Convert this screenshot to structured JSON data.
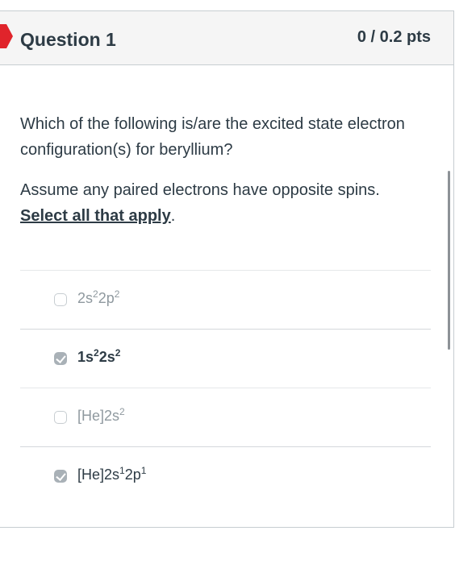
{
  "question": {
    "title": "Question 1",
    "points": "0 / 0.2 pts",
    "flag_icon": "flag-icon",
    "flag_color": "#e0242b"
  },
  "prompt": {
    "line1": "Which of the following is/are the excited state electron configuration(s) for beryllium?",
    "line2_prefix": "Assume any paired electrons have opposite spins.",
    "line2_emph": "Select all that apply",
    "line2_suffix": "."
  },
  "answers": [
    {
      "base": "2s",
      "sup1": "2",
      "mid": "2p",
      "sup2": "2",
      "checked": false
    },
    {
      "base": "1s",
      "sup1": "2",
      "mid": "2s",
      "sup2": "2",
      "checked": true
    },
    {
      "base": "[He]2s",
      "sup1": "2",
      "mid": "",
      "sup2": "",
      "checked": false
    },
    {
      "base": "[He]2s",
      "sup1": "1",
      "mid": "2p",
      "sup2": "1",
      "checked": true
    }
  ],
  "colors": {
    "text": "#2d3b45",
    "muted": "#8f999f",
    "header_bg": "#f5f5f5",
    "border": "#c7cdd1",
    "checkbox_checked": "#a9b1b7"
  }
}
